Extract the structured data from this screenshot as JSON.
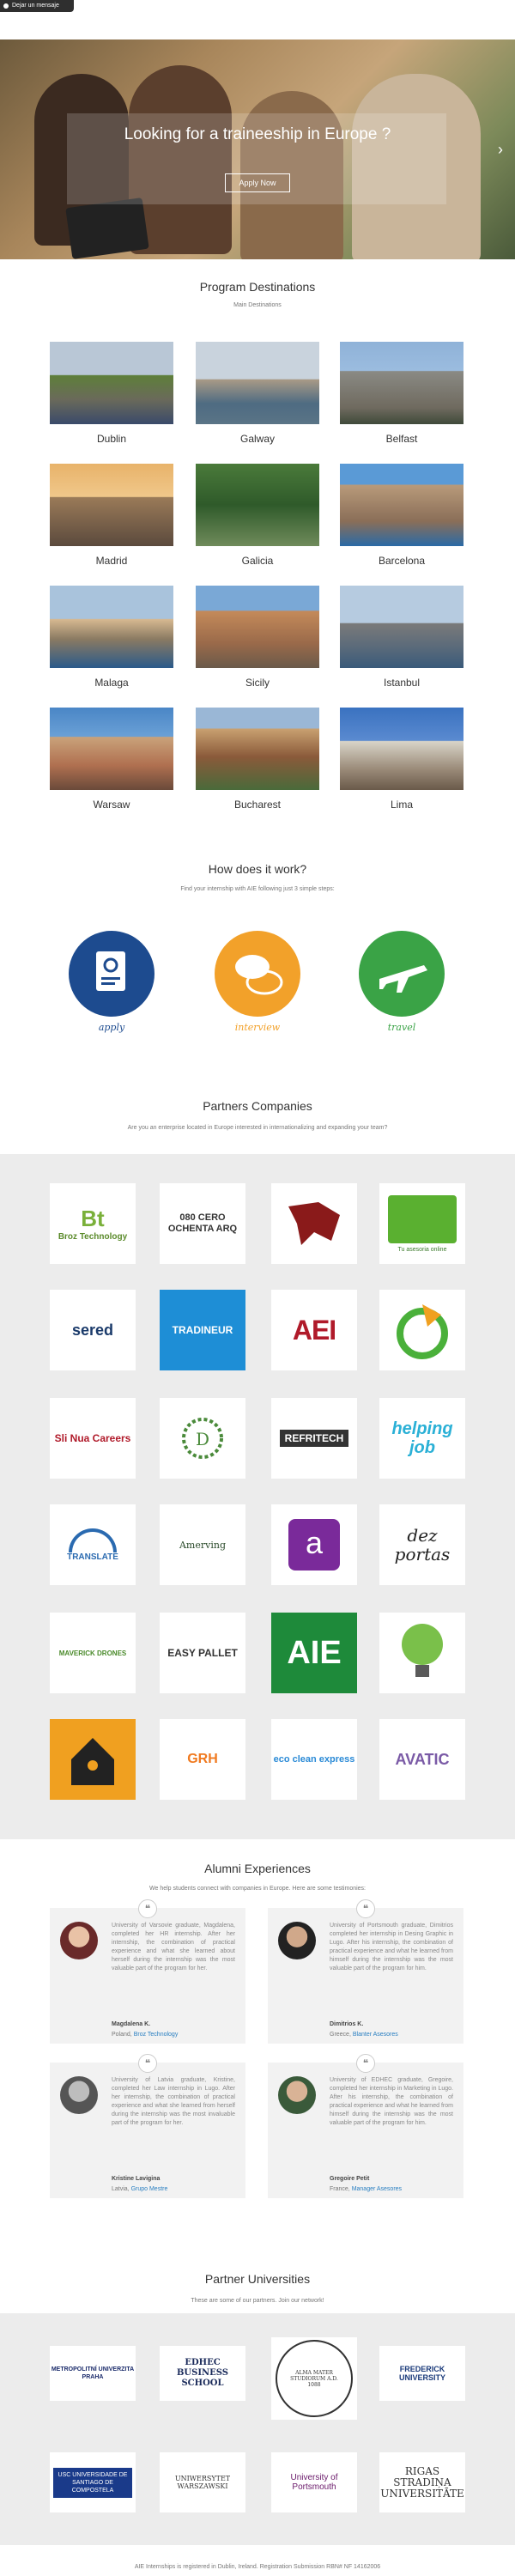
{
  "top_button": {
    "label": "Dejar un mensaje"
  },
  "hero": {
    "title": "Looking for a traineeship in Europe ?",
    "button": "Apply Now",
    "arrow": "›"
  },
  "destinations": {
    "title": "Program Destinations",
    "subtitle": "Main Destinations",
    "items": [
      "Dublin",
      "Galway",
      "Belfast",
      "Madrid",
      "Galicia",
      "Barcelona",
      "Malaga",
      "Sicily",
      "Istanbul",
      "Warsaw",
      "Bucharest",
      "Lima"
    ]
  },
  "how": {
    "title": "How does it work?",
    "subtitle": "Find your internship with AIE following just 3 simple steps:",
    "steps": [
      "apply",
      "interview",
      "travel"
    ],
    "colors": [
      "#1d4b8f",
      "#f2a12a",
      "#3aa346"
    ]
  },
  "partners": {
    "title": "Partners Companies",
    "subtitle": "Are you an enterprise located in Europe interested in internationalizing and expanding your team?",
    "logos": [
      "Broz Technology",
      "080 CERO OCHENTA ARQ",
      "",
      "Tu asesoria online",
      "sered",
      "TRADINEUR",
      "AEI",
      "",
      "Sli Nua Careers",
      "",
      "REFRITECH",
      "helping job",
      "TRANSLATE",
      "Amerving",
      "a",
      "dez portas",
      "MAVERICK DRONES",
      "EASY PALLET",
      "AIE",
      "",
      "",
      "GRH",
      "eco clean express",
      "AVATIC"
    ]
  },
  "alumni": {
    "title": "Alumni Experiences",
    "subtitle": "We help students connect with companies in Europe. Here are some testimonies:",
    "quote_mark": "❝",
    "cards": [
      {
        "text": "University of Varsovie graduate, Magdalena, completed her HR internship. After her internship, the combination of practical experience and what she learned about herself during the internship was the most valuable part of the program for her.",
        "name": "Magdalena K.",
        "country": "Poland,",
        "company": "Broz Technology"
      },
      {
        "text": "University of Portsmouth graduate, Dimitrios completed her internship in Desing Graphic in Lugo. After his internship, the combination of practical experience and what he learned from himself during the internship was the most valuable part of the program for him.",
        "name": "Dimitrios K.",
        "country": "Greece,",
        "company": "Blanter Asesores"
      },
      {
        "text": "University of Latvia graduate, Kristine, completed her Law internship in Lugo. After her internship, the combination of practical experience and what she learned from herself during the internship was the most invaluable part of the program for her.",
        "name": "Kristine Lavigina",
        "country": "Latvia,",
        "company": "Grupo Mestre"
      },
      {
        "text": "University of EDHEC graduate, Gregoire, completed her internship in Marketing in Lugo. After his internship, the combination of practical experience and what he learned from himself during the internship was the most valuable part of the program for him.",
        "name": "Gregoire Petit",
        "country": "France,",
        "company": "Manager Asesores"
      }
    ]
  },
  "universities": {
    "title": "Partner Universities",
    "subtitle": "These are some of our partners. Join our network!",
    "logos": [
      "METROPOLITNÍ UNIVERZITA PRAHA",
      "EDHEC BUSINESS SCHOOL",
      "ALMA MATER STUDIORUM A.D. 1088",
      "FREDERICK UNIVERSITY",
      "USC UNIVERSIDADE DE SANTIAGO DE COMPOSTELA",
      "UNIWERSYTET WARSZAWSKI",
      "University of Portsmouth",
      "RIGAS STRADIŅA UNIVERSITĀTE"
    ]
  },
  "footer": {
    "text": "AIE Internships is registered in Dublin, Ireland. Registration Submission RBN# NF 14162006"
  }
}
